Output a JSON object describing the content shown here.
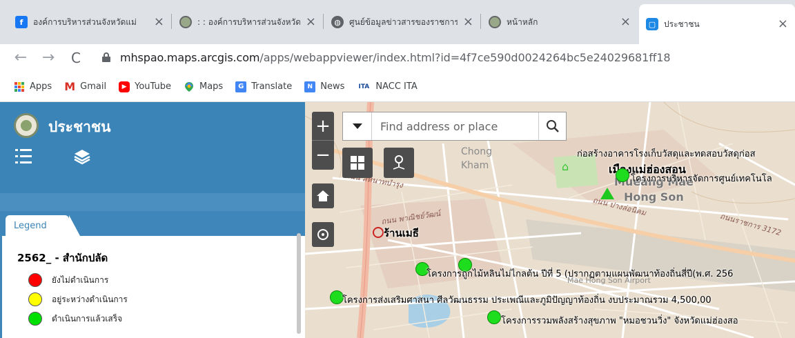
{
  "browser": {
    "tabs": [
      {
        "title": "องค์การบริหารส่วนจังหวัดแม่",
        "active": false
      },
      {
        "title": ": : องค์การบริหารส่วนจังหวัดแม่",
        "active": false
      },
      {
        "title": "ศูนย์ข้อมูลข่าวสารของราชการ",
        "active": false
      },
      {
        "title": "หน้าหลัก",
        "active": false
      },
      {
        "title": "ประชาชน",
        "active": true
      }
    ],
    "url_host": "mhspao.maps.arcgis.com",
    "url_path": "/apps/webappviewer/index.html?id=4f7ce590d0024264bc5e24029681ff18",
    "bookmarks": [
      "Apps",
      "Gmail",
      "YouTube",
      "Maps",
      "Translate",
      "News",
      "NACC ITA"
    ],
    "bookmark_badges": {
      "news": "N",
      "nacc": "ITA"
    }
  },
  "panel": {
    "title": "ประชาชน",
    "legend_tab": "Legend",
    "layer_title": "2562_ - สำนักปลัด",
    "legend_items": [
      {
        "label": "ยังไม่ดำเนินการ",
        "color": "#ff0000"
      },
      {
        "label": "อยู่ระหว่างดำเนินการ",
        "color": "#ffff00"
      },
      {
        "label": "ดำเนินการแล้วเสร็จ",
        "color": "#00e000"
      }
    ]
  },
  "map": {
    "search_placeholder": "Find address or place",
    "zoom_in": "+",
    "zoom_out": "−",
    "labels": {
      "chong": "Chong",
      "kham": "Kham",
      "town_th": "เมืองแม่ฮ่องสอน",
      "town_en_1": "Mueang Mae",
      "town_en_2": "Hong Son",
      "ran_mee": "ร้านเมธี",
      "airport": "Mae Hong Son Airport",
      "road_1": "ถนน พาณิชย์วัฒน์",
      "road_2": "ถนน ปางล่อนิคม",
      "road_3": "ถนนราชการ 3172",
      "road_4": "ถนน สีหนาทบำรุง"
    },
    "projects": [
      "ก่อสร้างอาคารโรงเก็บวัสดุและทดสอบวัสดุก่อส",
      "โครงการบริหารจัดการศูนย์เทคโนโล",
      "โครงการถูกไม้หลินไม่ไกลต้น ปีที่ 5 (ปรากฏตามแผนพัฒนาท้องถิ่นสี่ปี(พ.ศ. 256",
      "โครงการส่งเสริมศาสนา ศีลวัฒนธรรม ประเพณีและภูมิปัญญาท้องถิ่น งบประมาณรวม 4,500,00",
      "โครงการรวมพลังสร้างสุขภาพ \"หมอชวนวิ่ง\" จังหวัดแม่ฮ่องสอ"
    ]
  },
  "colors": {
    "panel_header": "#3a84b8",
    "completed_marker": "#1edc1e"
  }
}
